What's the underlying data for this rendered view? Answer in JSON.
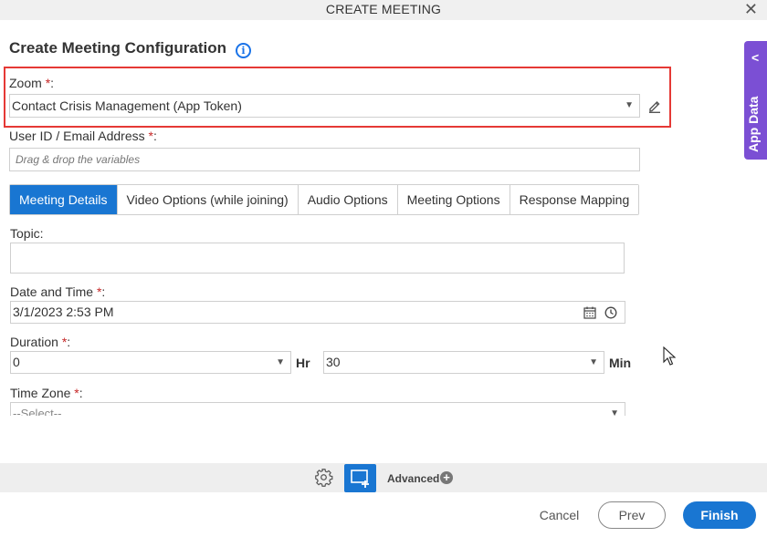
{
  "window": {
    "title": "CREATE MEETING",
    "close_label": "✕"
  },
  "page": {
    "heading": "Create Meeting Configuration",
    "info_icon": "i"
  },
  "zoom": {
    "label": "Zoom",
    "required": "*",
    "colon": ":",
    "value": "Contact Crisis Management (App Token)"
  },
  "user": {
    "label": "User ID / Email Address",
    "required": "*",
    "colon": ":",
    "placeholder": "Drag & drop the variables"
  },
  "tabs": [
    {
      "label": "Meeting Details",
      "active": true
    },
    {
      "label": "Video Options (while joining)",
      "active": false
    },
    {
      "label": "Audio Options",
      "active": false
    },
    {
      "label": "Meeting Options",
      "active": false
    },
    {
      "label": "Response Mapping",
      "active": false
    }
  ],
  "topic": {
    "label": "Topic:",
    "value": ""
  },
  "datetime": {
    "label": "Date and Time",
    "required": "*",
    "colon": ":",
    "value": "3/1/2023 2:53 PM"
  },
  "duration": {
    "label": "Duration",
    "required": "*",
    "colon": ":",
    "hours": "0",
    "hours_unit": "Hr",
    "minutes": "30",
    "minutes_unit": "Min"
  },
  "timezone": {
    "label": "Time Zone",
    "required": "*",
    "colon": ":",
    "value": "--Select--"
  },
  "sidebar": {
    "label": "App Data"
  },
  "toolbar": {
    "advanced_label": "Advanced"
  },
  "footer": {
    "cancel": "Cancel",
    "prev": "Prev",
    "finish": "Finish"
  },
  "colors": {
    "accent": "#1976d2",
    "sidebar": "#7b4fd4",
    "highlight": "#e53935",
    "required": "#c62828"
  }
}
